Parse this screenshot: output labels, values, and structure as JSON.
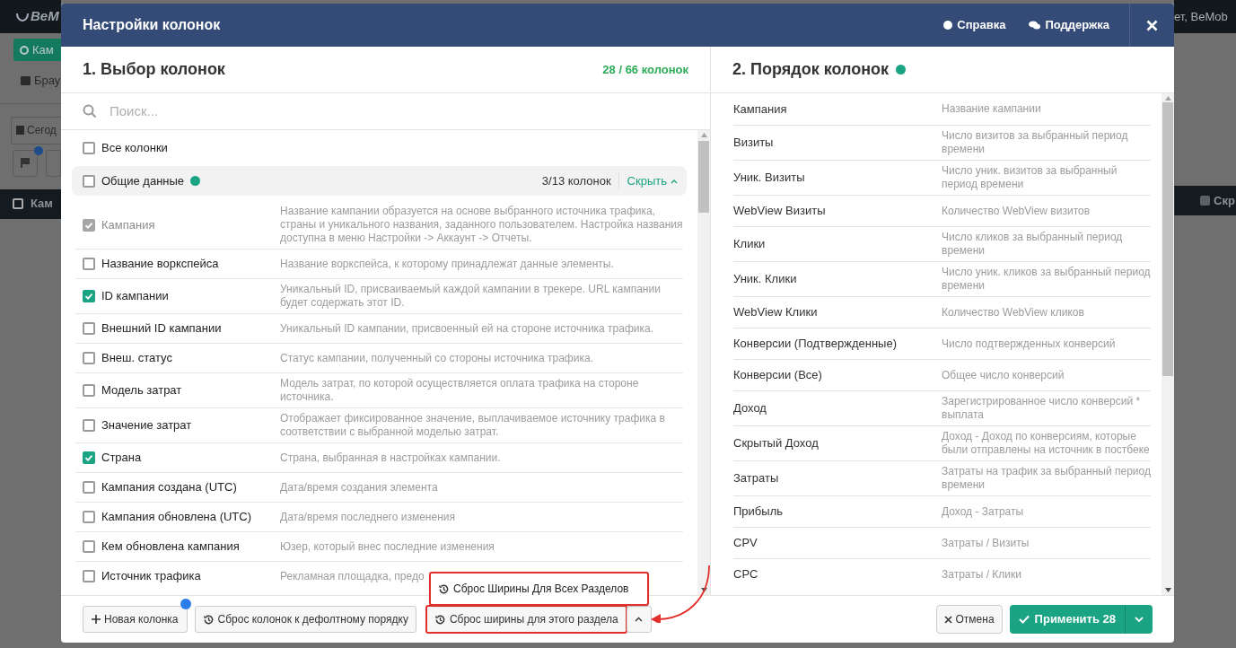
{
  "background": {
    "logo": "BeM",
    "nav_button": "Кам",
    "browser_tab": "Брау",
    "date_button": "Сегод",
    "table_header_left": "Кам",
    "header_checkbox": {
      "checked": false
    },
    "greeting": "ет, BeMob",
    "table_header_right": "Скр"
  },
  "modal": {
    "title": "Настройки колонок",
    "help_link": "Справка",
    "support_link": "Поддержка"
  },
  "selection": {
    "title": "1. Выбор колонок",
    "count": "28 / 66 колонок",
    "search": {
      "placeholder": "Поиск..."
    },
    "all_columns": {
      "label": "Все колонки",
      "checked": false
    },
    "group": {
      "label": "Общие данные",
      "checked": false,
      "count": "3/13 колонок",
      "toggle": "Скрыть",
      "expanded": true
    },
    "columns": [
      {
        "label": "Кампания",
        "description": "Название кампании образуется на основе выбранного источника трафика, страны и уникального названия, заданного пользователем. Настройка названия доступна в меню Настройки -> Аккаунт -> Отчеты.",
        "checked": true,
        "disabled": true
      },
      {
        "label": "Название воркспейса",
        "description": "Название воркспейса, к которому принадлежат данные элементы.",
        "checked": false,
        "disabled": false
      },
      {
        "label": "ID кампании",
        "description": "Уникальный ID, присваиваемый каждой кампании в трекере. URL кампании будет содержать этот ID.",
        "checked": true,
        "disabled": false
      },
      {
        "label": "Внешний ID кампании",
        "description": "Уникальный ID кампании, присвоенный ей на стороне источника трафика.",
        "checked": false,
        "disabled": false
      },
      {
        "label": "Внеш. статус",
        "description": "Статус кампании, полученный со стороны источника трафика.",
        "checked": false,
        "disabled": false
      },
      {
        "label": "Модель затрат",
        "description": "Модель затрат, по которой осуществляется оплата трафика на стороне источника.",
        "checked": false,
        "disabled": false
      },
      {
        "label": "Значение затрат",
        "description": "Отображает фиксированное значение, выплачиваемое источнику трафика в соответствии с выбранной моделью затрат.",
        "checked": false,
        "disabled": false
      },
      {
        "label": "Страна",
        "description": "Страна, выбранная в настройках кампании.",
        "checked": true,
        "disabled": false
      },
      {
        "label": "Кампания создана (UTC)",
        "description": "Дата/время создания элемента",
        "checked": false,
        "disabled": false
      },
      {
        "label": "Кампания обновлена (UTC)",
        "description": "Дата/время последнего изменения",
        "checked": false,
        "disabled": false
      },
      {
        "label": "Кем обновлена кампания",
        "description": "Юзер, который внес последние изменения",
        "checked": false,
        "disabled": false
      },
      {
        "label": "Источник трафика",
        "description": "Рекламная площадка, предо",
        "checked": false,
        "disabled": false
      }
    ]
  },
  "order": {
    "title": "2. Порядок колонок",
    "columns": [
      {
        "label": "Кампания",
        "description": "Название кампании"
      },
      {
        "label": "Визиты",
        "description": "Число визитов за выбранный период времени"
      },
      {
        "label": "Уник. Визиты",
        "description": "Число уник. визитов за выбранный период времени"
      },
      {
        "label": "WebView Визиты",
        "description": "Количество WebView визитов"
      },
      {
        "label": "Клики",
        "description": "Число кликов за выбранный период времени"
      },
      {
        "label": "Уник. Клики",
        "description": "Число уник. кликов за выбранный период времени"
      },
      {
        "label": "WebView Клики",
        "description": "Количество WebView кликов"
      },
      {
        "label": "Конверсии (Подтвержденные)",
        "description": "Число подтвержденных конверсий"
      },
      {
        "label": "Конверсии (Все)",
        "description": "Общее число конверсий"
      },
      {
        "label": "Доход",
        "description": "Зарегистрированное число конверсий * выплата"
      },
      {
        "label": "Скрытый Доход",
        "description": "Доход - Доход по конверсиям, которые были отправлены на источник в постбеке"
      },
      {
        "label": "Затраты",
        "description": "Затраты на трафик за выбранный период времени"
      },
      {
        "label": "Прибыль",
        "description": "Доход - Затраты"
      },
      {
        "label": "CPV",
        "description": "Затраты / Визиты"
      },
      {
        "label": "CPC",
        "description": "Затраты / Клики"
      }
    ]
  },
  "footer": {
    "new_column": "Новая колонка",
    "reset_order": "Сброс колонок к дефолтному порядку",
    "reset_width": {
      "label": "Сброс ширины для этого раздела",
      "highlighted": true
    },
    "menu": {
      "open": true,
      "item": "Сброс Ширины Для Всех Разделов",
      "highlighted": true
    },
    "cancel": "Отмена",
    "apply": "Применить 28"
  }
}
